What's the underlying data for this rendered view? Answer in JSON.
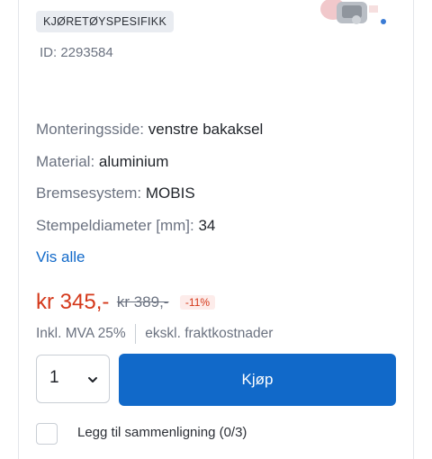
{
  "badge": {
    "label": "KJØRETØYSPESIFIKK"
  },
  "product": {
    "id_text": "ID: 2293584"
  },
  "specs": [
    {
      "label": "Monteringsside:",
      "value": "venstre bakaksel"
    },
    {
      "label": "Material:",
      "value": "aluminium"
    },
    {
      "label": "Bremsesystem:",
      "value": "MOBIS"
    },
    {
      "label": "Stempeldiameter [mm]:",
      "value": "34"
    }
  ],
  "show_all_label": "Vis alle",
  "price": {
    "current": "kr 345,-",
    "old": "kr 389,-",
    "discount": "-11%",
    "vat": "Inkl. MVA 25%",
    "shipping": "ekskl. fraktkostnader"
  },
  "quantity": {
    "value": "1"
  },
  "buy_label": "Kjøp",
  "compare_label": "Legg til sammenligning (0/3)",
  "colors": {
    "accent": "#1169c9",
    "price_red": "#d4381a"
  }
}
